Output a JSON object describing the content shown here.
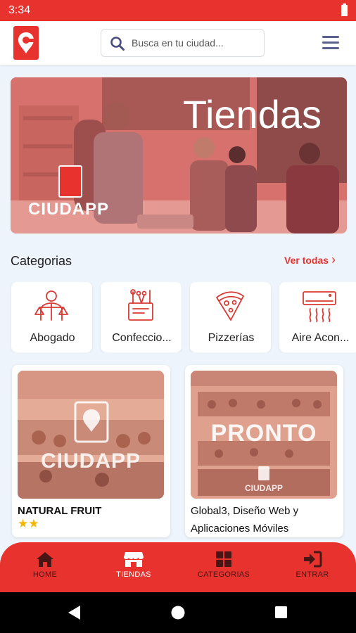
{
  "status_bar": {
    "time": "3:34"
  },
  "header": {
    "logo_icon": "ciudapp-logo-icon",
    "search_placeholder": "Busca en tu ciudad...",
    "search_icon": "search-icon",
    "menu_icon": "hamburger-menu-icon"
  },
  "hero": {
    "title": "Tiendas",
    "brand": "CIUDAPP"
  },
  "categories": {
    "title": "Categorias",
    "see_all": "Ver todas",
    "items": [
      {
        "label": "Abogado",
        "icon": "lawyer-icon"
      },
      {
        "label": "Confeccio...",
        "icon": "sewing-icon"
      },
      {
        "label": "Pizzerías",
        "icon": "pizza-icon"
      },
      {
        "label": "Aire Acon...",
        "icon": "air-conditioner-icon"
      }
    ]
  },
  "stores": [
    {
      "name": "NATURAL FRUIT",
      "rating": 2,
      "image_text": "CIUDAPP"
    },
    {
      "name": "Global3, Diseño Web y Aplicaciones Móviles",
      "rating": 0,
      "image_text": "PRONTO",
      "image_subtext": "CIUDAPP"
    }
  ],
  "bottom_nav": {
    "items": [
      {
        "label": "HOME",
        "icon": "home-icon"
      },
      {
        "label": "TIENDAS",
        "icon": "store-icon",
        "active": true
      },
      {
        "label": "CATEGORIAS",
        "icon": "grid-icon"
      },
      {
        "label": "ENTRAR",
        "icon": "sign-in-icon"
      }
    ]
  },
  "colors": {
    "brand_red": "#e8322d",
    "star_gold": "#f5b400",
    "background": "#eef4fc"
  }
}
